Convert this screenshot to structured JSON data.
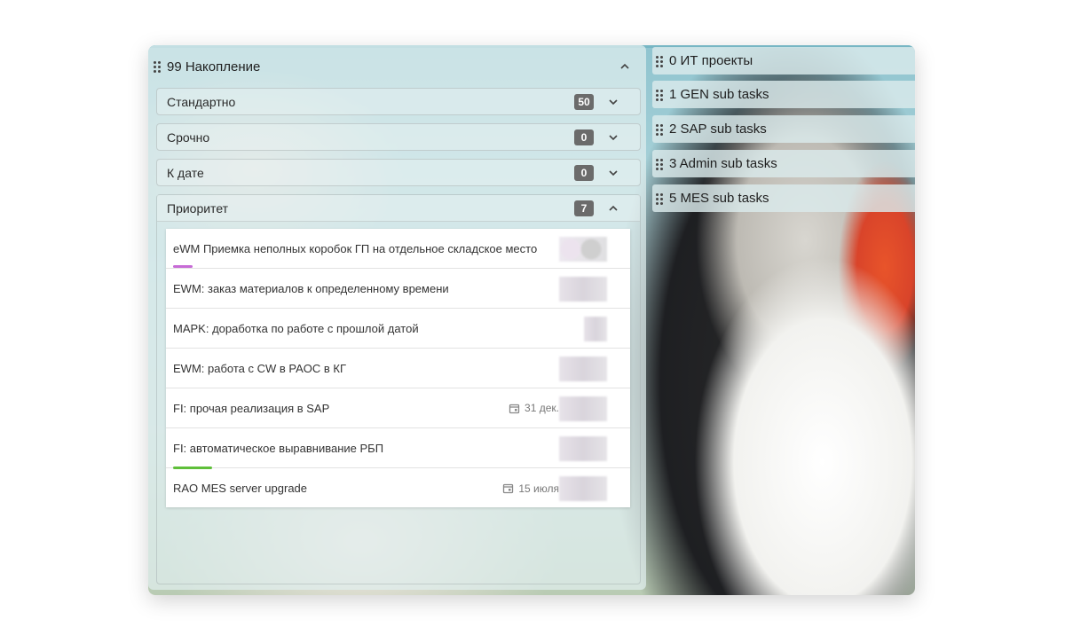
{
  "columns": {
    "main": {
      "title": "99 Накопление",
      "groups": [
        {
          "label": "Стандартно",
          "count": "50"
        },
        {
          "label": "Срочно",
          "count": "0"
        },
        {
          "label": "К дате",
          "count": "0"
        },
        {
          "label": "Приоритет",
          "count": "7"
        }
      ],
      "cards": [
        {
          "title": "eWM Приемка неполных коробок ГП на отдельное складское место",
          "date": ""
        },
        {
          "title": "EWM: заказ материалов к определенному времени",
          "date": ""
        },
        {
          "title": "MAPK: доработка по работе с прошлой датой",
          "date": ""
        },
        {
          "title": "EWM: работа с CW в PAOC в КГ",
          "date": ""
        },
        {
          "title": "FI: прочая реализация в SAP",
          "date": "31 дек."
        },
        {
          "title": "FI: автоматическое выравнивание РБП",
          "date": ""
        },
        {
          "title": "RAO MES server upgrade",
          "date": "15 июля"
        }
      ]
    },
    "side": [
      {
        "title": "0 ИТ проекты"
      },
      {
        "title": "1 GEN sub tasks"
      },
      {
        "title": "2 SAP sub tasks"
      },
      {
        "title": "3 Admin sub tasks"
      },
      {
        "title": "5 MES sub tasks"
      }
    ]
  },
  "colors": {
    "badge": "#6b6b6b",
    "progress_purple": "#c76bd6",
    "progress_green": "#5fbf3a"
  },
  "icons": {
    "drag": "drag-handle-icon",
    "collapse": "chevron-up-icon",
    "expand": "chevron-down-icon",
    "date": "calendar-icon"
  }
}
